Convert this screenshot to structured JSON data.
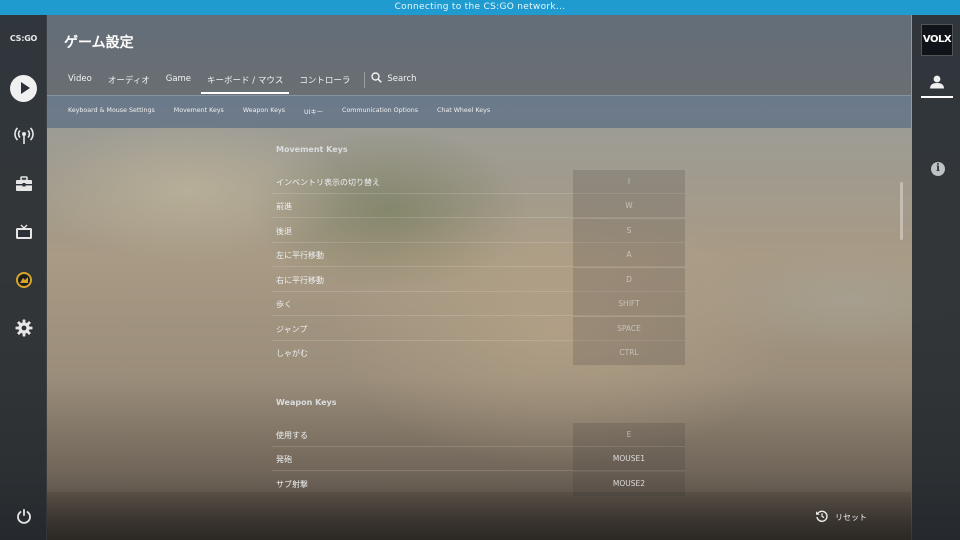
{
  "status_bar": {
    "text": "Connecting to the CS:GO network..."
  },
  "sidebar": {
    "logo": "CS:GO",
    "items": [
      {
        "name": "play-icon"
      },
      {
        "name": "broadcast-icon"
      },
      {
        "name": "inventory-icon"
      },
      {
        "name": "watch-icon"
      },
      {
        "name": "awards-icon"
      },
      {
        "name": "gear-icon"
      },
      {
        "name": "power-icon"
      }
    ]
  },
  "right_panel": {
    "badge": "VOLX",
    "icons": [
      "user-icon",
      "info-icon"
    ],
    "info_glyph": "i"
  },
  "header": {
    "title": "ゲーム設定",
    "tabs": [
      "Video",
      "オーディオ",
      "Game",
      "キーボード / マウス",
      "コントローラ"
    ],
    "active_tab": "キーボード / マウス",
    "search_label": "Search"
  },
  "subtabs": [
    "Keyboard & Mouse Settings",
    "Movement Keys",
    "Weapon Keys",
    "UIキー",
    "Communication Options",
    "Chat Wheel Keys"
  ],
  "sections": [
    {
      "title": "Movement Keys",
      "rows": [
        {
          "label": "インベントリ表示の切り替え",
          "key": "I"
        },
        {
          "label": "前進",
          "key": "W"
        },
        {
          "label": "後退",
          "key": "S"
        },
        {
          "label": "左に平行移動",
          "key": "A"
        },
        {
          "label": "右に平行移動",
          "key": "D"
        },
        {
          "label": "歩く",
          "key": "SHIFT"
        },
        {
          "label": "ジャンプ",
          "key": "SPACE"
        },
        {
          "label": "しゃがむ",
          "key": "CTRL"
        }
      ]
    },
    {
      "title": "Weapon Keys",
      "rows": [
        {
          "label": "使用する",
          "key": "E"
        },
        {
          "label": "発砲",
          "key": "MOUSE1"
        },
        {
          "label": "サブ射撃",
          "key": "MOUSE2"
        }
      ]
    }
  ],
  "footer": {
    "reset_label": "リセット"
  }
}
